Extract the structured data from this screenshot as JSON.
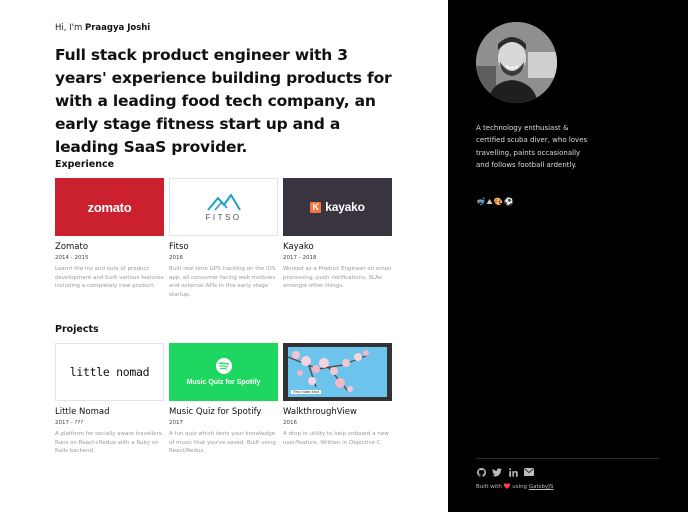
{
  "hero": {
    "greeting_prefix": "Hi, I'm",
    "name": "Praagya Joshi",
    "headline": "Full stack product engineer with 3 years' experience building products for with a leading food tech company, an early stage fitness start up and a leading SaaS provider."
  },
  "experience": {
    "title": "Experience",
    "items": [
      {
        "logo_text": "zomato",
        "name": "Zomato",
        "date": "2014 - 2015",
        "desc": "Learnt the ins and outs of product development and built various features including a completely new product."
      },
      {
        "logo_text": "FITSO",
        "name": "Fitso",
        "date": "2016",
        "desc": "Built real time GPS tracking on the iOS app, all consumer facing web modules and external APIs in this early stage startup."
      },
      {
        "logo_text": "kayako",
        "logo_mark": "K",
        "name": "Kayako",
        "date": "2017 - 2018",
        "desc": "Worked as a Product Engineer on email processing, push notifications, SLAs amongst other things."
      }
    ]
  },
  "projects": {
    "title": "Projects",
    "items": [
      {
        "logo_text": "little nomad",
        "name": "Little Nomad",
        "date": "2017 - ???",
        "desc": "A platform for socially aware travellers. Runs on React+Redux with a Ruby on Rails backend."
      },
      {
        "logo_text": "Music Quiz for Spotify",
        "name": "Music Quiz for Spotify",
        "date": "2017",
        "desc": "A fun quiz which tests your knowledge of music that you've saved. Built using React/Redux."
      },
      {
        "screen_label": "First index text",
        "name": "WalkthroughView",
        "date": "2016",
        "desc": "A drop in utility to help onboard a new user/feature. Written in Objective C"
      }
    ]
  },
  "sidebar": {
    "bio": "A technology enthusiast & certified scuba diver, who loves travelling, paints occasionally and follows football ardently.",
    "emojis": "🤿⛰🎨⚽",
    "social": [
      "github-icon",
      "twitter-icon",
      "linkedin-icon",
      "email-icon"
    ],
    "footer_prefix": "Built with",
    "footer_heart": "❤️",
    "footer_middle": "using",
    "footer_link": "GatsbyJS"
  },
  "colors": {
    "zomato": "#cb202d",
    "kayako_bg": "#3a3441",
    "kayako_accent": "#f0763d",
    "spotify": "#1ed760",
    "sidebar_bg": "#000000"
  }
}
